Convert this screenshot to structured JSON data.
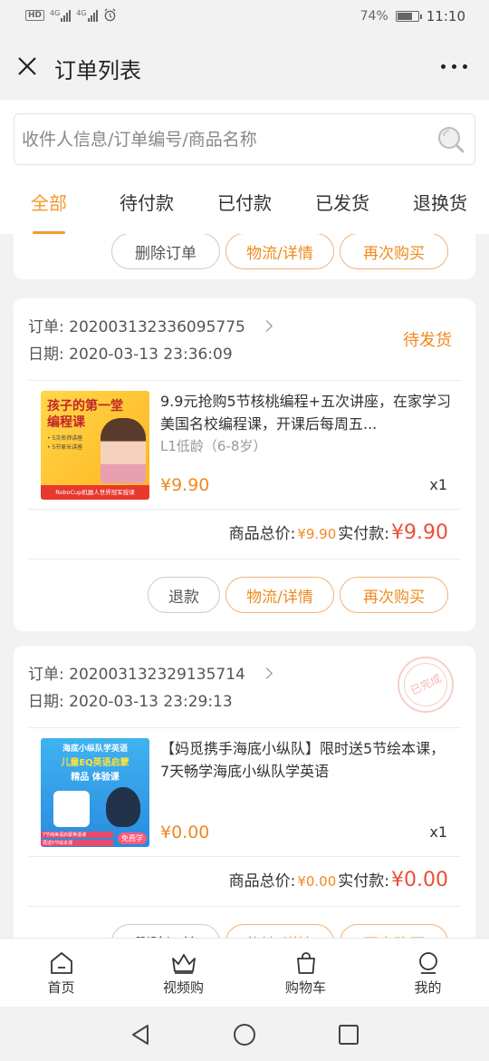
{
  "status_bar": {
    "left_icons": [
      "hd-icon",
      "signal-4g-icon",
      "signal-4g-icon",
      "alarm-icon"
    ],
    "network_label": "4G",
    "battery": "74%",
    "battery_level": 0.74,
    "time": "11:10"
  },
  "header": {
    "title": "订单列表"
  },
  "search": {
    "placeholder": "收件人信息/订单编号/商品名称"
  },
  "tabs": [
    {
      "label": "全部",
      "active": true
    },
    {
      "label": "待付款",
      "active": false
    },
    {
      "label": "已付款",
      "active": false
    },
    {
      "label": "已发货",
      "active": false
    },
    {
      "label": "退换货",
      "active": false
    }
  ],
  "top_card": {
    "buttons": [
      "删除订单",
      "物流/详情",
      "再次购买"
    ]
  },
  "orders": [
    {
      "order_label": "订单:",
      "order_no": "202003132336095775",
      "date_label": "日期:",
      "date": "2020-03-13 23:36:09",
      "status": "待发货",
      "product": {
        "name": "9.9元抢购5节核桃编程+五次讲座，在家学习美国名校编程课，开课后每周五...",
        "spec": "L1低龄（6-8岁）",
        "price": "¥9.90",
        "qty": "x1",
        "thumb": {
          "title1": "孩子的第一堂",
          "title2": "编程课",
          "line1": "• 5次名师讲座",
          "line2": "• 5节家长讲座",
          "footer": "RoboCup机器人世界冠军授课"
        }
      },
      "goods_total_label": "商品总价:",
      "goods_total": "¥9.90",
      "paid_label": "实付款:",
      "paid": "¥9.90",
      "buttons": [
        "退款",
        "物流/详情",
        "再次购买"
      ]
    },
    {
      "order_label": "订单:",
      "order_no": "202003132329135714",
      "date_label": "日期:",
      "date": "2020-03-13 23:29:13",
      "stamp": "已完成",
      "product": {
        "name": "【妈觅携手海底小纵队】限时送5节绘本课，7天畅学海底小纵队学英语",
        "price": "¥0.00",
        "qty": "x1",
        "thumb": {
          "title1": "海底小纵队学英语",
          "title2": "儿童EQ英语启蒙",
          "title3": "精品 体验课",
          "footer1": "7节纯美语启蒙英语课",
          "footer2": "再送5节绘本课",
          "badge": "免费学"
        }
      },
      "goods_total_label": "商品总价:",
      "goods_total": "¥0.00",
      "paid_label": "实付款:",
      "paid": "¥0.00",
      "buttons": [
        "删除订单",
        "物流/详情",
        "再次购买"
      ]
    }
  ],
  "bottom_nav": [
    {
      "label": "首页",
      "icon": "home-icon"
    },
    {
      "label": "视频购",
      "icon": "crown-icon"
    },
    {
      "label": "购物车",
      "icon": "shopping-bag-icon"
    },
    {
      "label": "我的",
      "icon": "profile-icon"
    }
  ],
  "system_nav": [
    "back-triangle-icon",
    "home-circle-icon",
    "recents-square-icon"
  ],
  "colors": {
    "accent": "#f39a2e",
    "price_red": "#e94f3a",
    "background": "#f2f2f2"
  }
}
